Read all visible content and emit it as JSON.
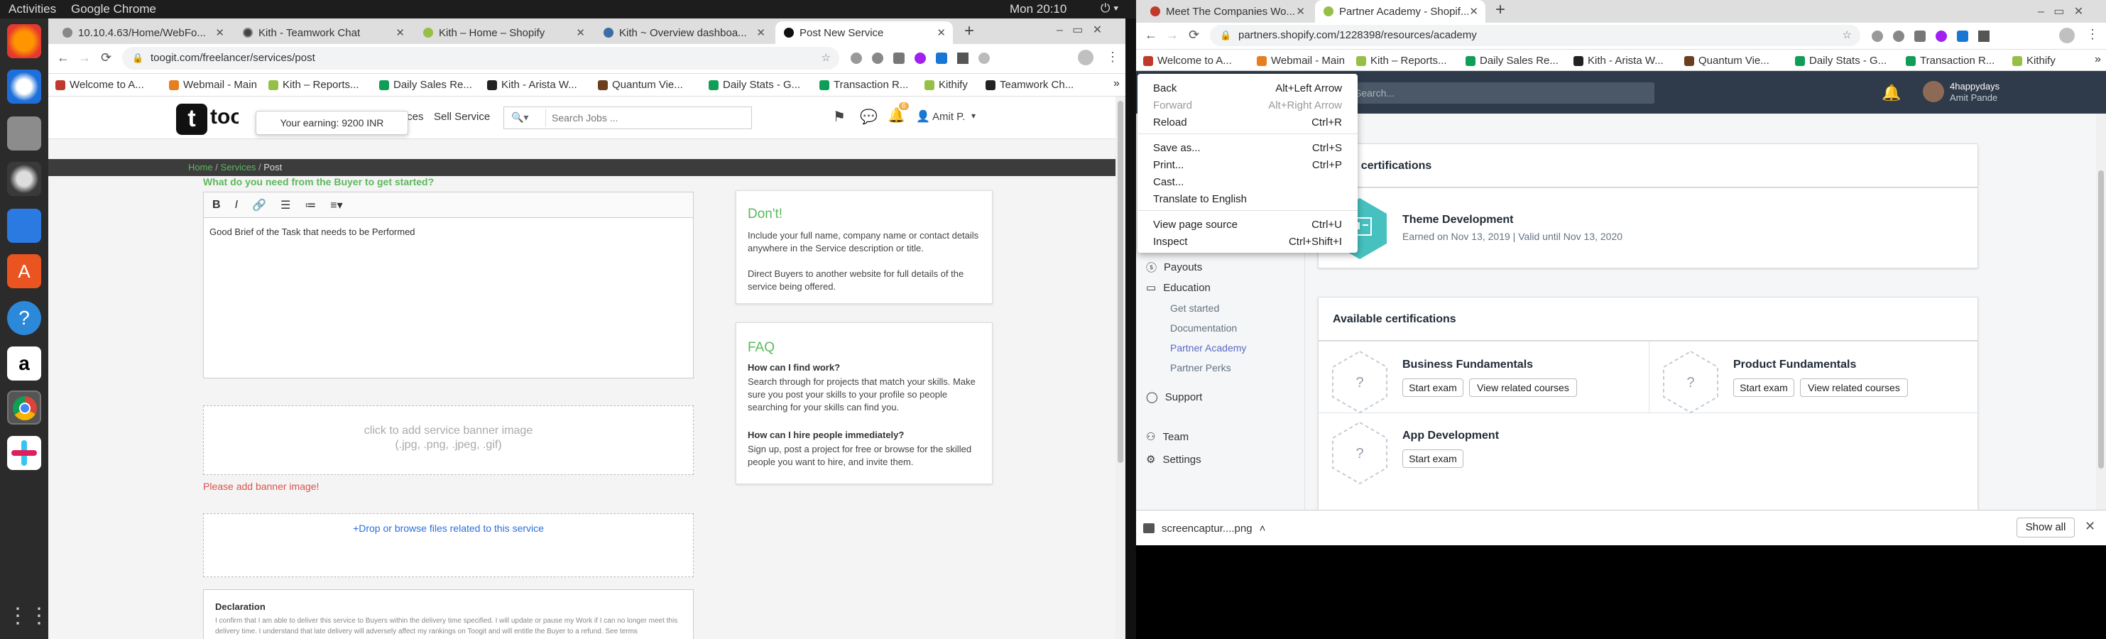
{
  "topbar": {
    "activities": "Activities",
    "app": "Google Chrome",
    "clock": "Mon 20:10"
  },
  "left": {
    "tabs": [
      "10.10.4.63/Home/WebFo...",
      "Kith - Teamwork Chat",
      "Kith – Home – Shopify",
      "Kith ~ Overview dashboa...",
      "Post New Service"
    ],
    "url": "toogit.com/freelancer/services/post",
    "bookmarks": [
      "Welcome to A...",
      "Webmail - Main",
      "Kith – Reports...",
      "Daily Sales Re...",
      "Kith - Arista W...",
      "Quantum Vie...",
      "Daily Stats - G...",
      "Transaction R...",
      "Kithify",
      "Teamwork Ch..."
    ],
    "site": {
      "logo": "toogit",
      "earning_tooltip": "Your earning: 9200 INR",
      "nav_services": "Services",
      "nav_sell": "Sell Service",
      "search_placeholder": "Search Jobs ...",
      "user": "Amit P.",
      "notif_count": "6",
      "breadcrumb": {
        "home": "Home",
        "services": "Services",
        "post": "Post"
      },
      "question": "What do you need from the Buyer to get started?",
      "editor_text": "Good Brief of the Task that needs to be Performed",
      "banner_line1": "click to add service banner image",
      "banner_line2": "(.jpg, .png, .jpeg, .gif)",
      "banner_error": "Please add banner image!",
      "drop_text": "Drop or browse files related to this service",
      "declaration_title": "Declaration",
      "declaration_text": "I confirm that I am able to deliver this service to Buyers within the delivery time specified. I will update or pause my Work if I can no longer meet this delivery time. I understand that late delivery will adversely affect my rankings on Toogit and will entitle the Buyer to a refund. See terms",
      "dont_title": "Don't!",
      "dont_p1": "Include your full name, company name or contact details anywhere in the Service description or title.",
      "dont_p2": "Direct Buyers to another website for full details of the service being offered.",
      "faq_title": "FAQ",
      "faq_q1": "How can I find work?",
      "faq_a1": "Search through for projects that match your skills. Make sure you post your skills to your profile so people searching for your skills can find you.",
      "faq_q2": "How can I hire people immediately?",
      "faq_a2": "Sign up, post a project for free or browse for the skilled people you want to hire, and invite them."
    }
  },
  "right": {
    "tabs": [
      "Meet The Companies Wo...",
      "Partner Academy - Shopif..."
    ],
    "url": "partners.shopify.com/1228398/resources/academy",
    "bookmarks": [
      "Welcome to A...",
      "Webmail - Main",
      "Kith – Reports...",
      "Daily Sales Re...",
      "Kith - Arista W...",
      "Quantum Vie...",
      "Daily Stats - G...",
      "Transaction R...",
      "Kithify"
    ],
    "context_menu": [
      {
        "label": "Back",
        "shortcut": "Alt+Left Arrow",
        "enabled": true
      },
      {
        "label": "Forward",
        "shortcut": "Alt+Right Arrow",
        "enabled": false
      },
      {
        "label": "Reload",
        "shortcut": "Ctrl+R",
        "enabled": true
      },
      {
        "label": "Save as...",
        "shortcut": "Ctrl+S",
        "enabled": true
      },
      {
        "label": "Print...",
        "shortcut": "Ctrl+P",
        "enabled": true
      },
      {
        "label": "Cast...",
        "shortcut": "",
        "enabled": true
      },
      {
        "label": "Translate to English",
        "shortcut": "",
        "enabled": true
      },
      {
        "label": "View page source",
        "shortcut": "Ctrl+U",
        "enabled": true
      },
      {
        "label": "Inspect",
        "shortcut": "Ctrl+Shift+I",
        "enabled": true
      }
    ],
    "header": {
      "search_placeholder": "Search...",
      "store": "4happydays",
      "user": "Amit Pande"
    },
    "sidebar": {
      "payouts": "Payouts",
      "education": "Education",
      "get_started": "Get started",
      "documentation": "Documentation",
      "partner_academy": "Partner Academy",
      "partner_perks": "Partner Perks",
      "support": "Support",
      "team": "Team",
      "settings": "Settings"
    },
    "your_certs_title": "Your certifications",
    "cert": {
      "name": "Theme Development",
      "earned": "Earned on Nov 13, 2019 | Valid until Nov 13, 2020"
    },
    "available_title": "Available certifications",
    "available": [
      {
        "name": "Business Fundamentals",
        "start": "Start exam",
        "related": "View related courses"
      },
      {
        "name": "Product Fundamentals",
        "start": "Start exam",
        "related": "View related courses"
      },
      {
        "name": "App Development",
        "start": "Start exam"
      }
    ],
    "download": {
      "file": "screencaptur....png",
      "show_all": "Show all"
    }
  },
  "colors": {
    "toogit_green": "#5cb85c",
    "shopify_dark": "#2f3b4a",
    "link_blue": "#5c6ac4",
    "error_red": "#d9534f"
  }
}
